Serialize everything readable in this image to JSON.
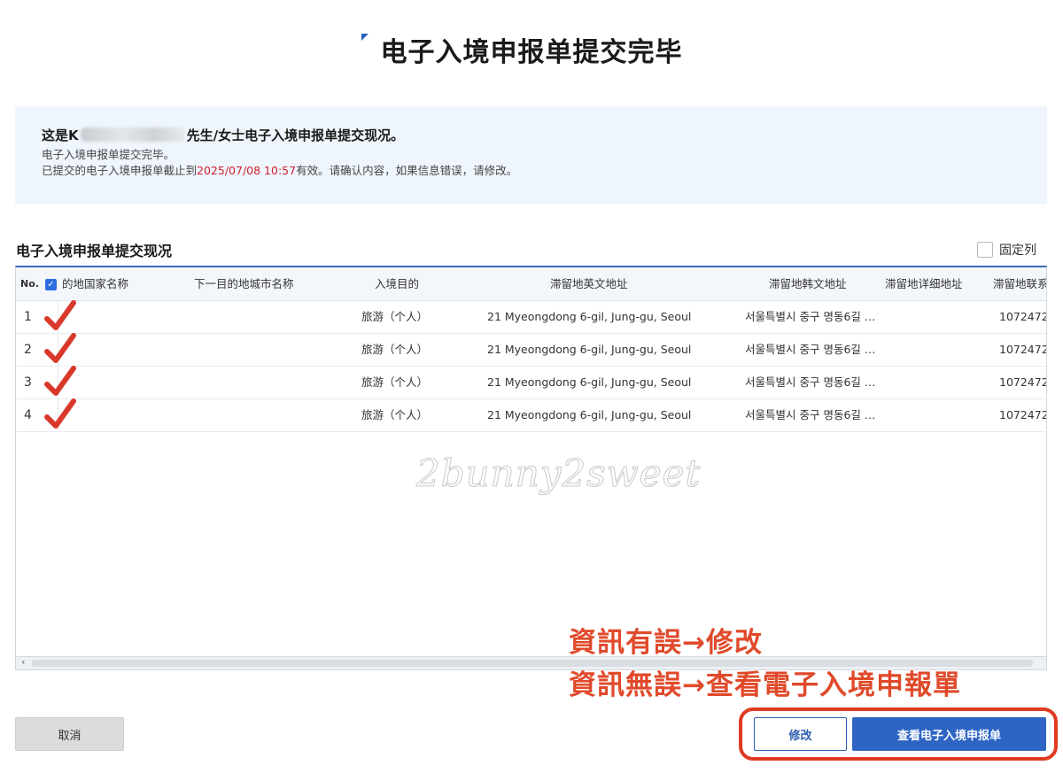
{
  "page": {
    "title": "电子入境申报单提交完毕"
  },
  "info": {
    "headline_prefix": "这是K",
    "headline_suffix": "先生/女士电子入境申报单提交现况。",
    "line1": "电子入境申报单提交完毕。",
    "line2_prefix": "已提交的电子入境申报单截止到",
    "deadline": "2025/07/08 10:57",
    "line2_suffix": "有效。请确认内容，如果信息错误，请修改。"
  },
  "section": {
    "title": "电子入境申报单提交现况",
    "fix_columns_label": "固定列"
  },
  "table": {
    "headers": {
      "no": "No.",
      "country": "的地国家名称",
      "next_city": "下一目的地城市名称",
      "purpose": "入境目的",
      "addr_en": "滞留地英文地址",
      "addr_ko": "滞留地韩文地址",
      "addr_detail": "滞留地详细地址",
      "contact": "滞留地联系"
    },
    "rows": [
      {
        "no": "1",
        "purpose": "旅游（个人）",
        "addr_en": "21 Myeongdong 6-gil, Jung-gu, Seoul",
        "addr_ko": "서울특별시 중구 명동6길 …",
        "contact": "1072472"
      },
      {
        "no": "2",
        "purpose": "旅游（个人）",
        "addr_en": "21 Myeongdong 6-gil, Jung-gu, Seoul",
        "addr_ko": "서울특별시 중구 명동6길 …",
        "contact": "1072472"
      },
      {
        "no": "3",
        "purpose": "旅游（个人）",
        "addr_en": "21 Myeongdong 6-gil, Jung-gu, Seoul",
        "addr_ko": "서울특별시 중구 명동6길 …",
        "contact": "1072472"
      },
      {
        "no": "4",
        "purpose": "旅游（个人）",
        "addr_en": "21 Myeongdong 6-gil, Jung-gu, Seoul",
        "addr_ko": "서울특별시 중구 명동6길 …",
        "contact": "1072472"
      }
    ]
  },
  "watermark": "2bunny2sweet",
  "annotation": {
    "line1": "資訊有誤→修改",
    "line2": "資訊無誤→查看電子入境申報單",
    "color": "#e04a2b"
  },
  "buttons": {
    "cancel": "取消",
    "edit": "修改",
    "view": "查看电子入境申报单"
  },
  "colors": {
    "primary": "#2e65c4",
    "deadline": "#d0202f",
    "check": "#d8392b"
  }
}
